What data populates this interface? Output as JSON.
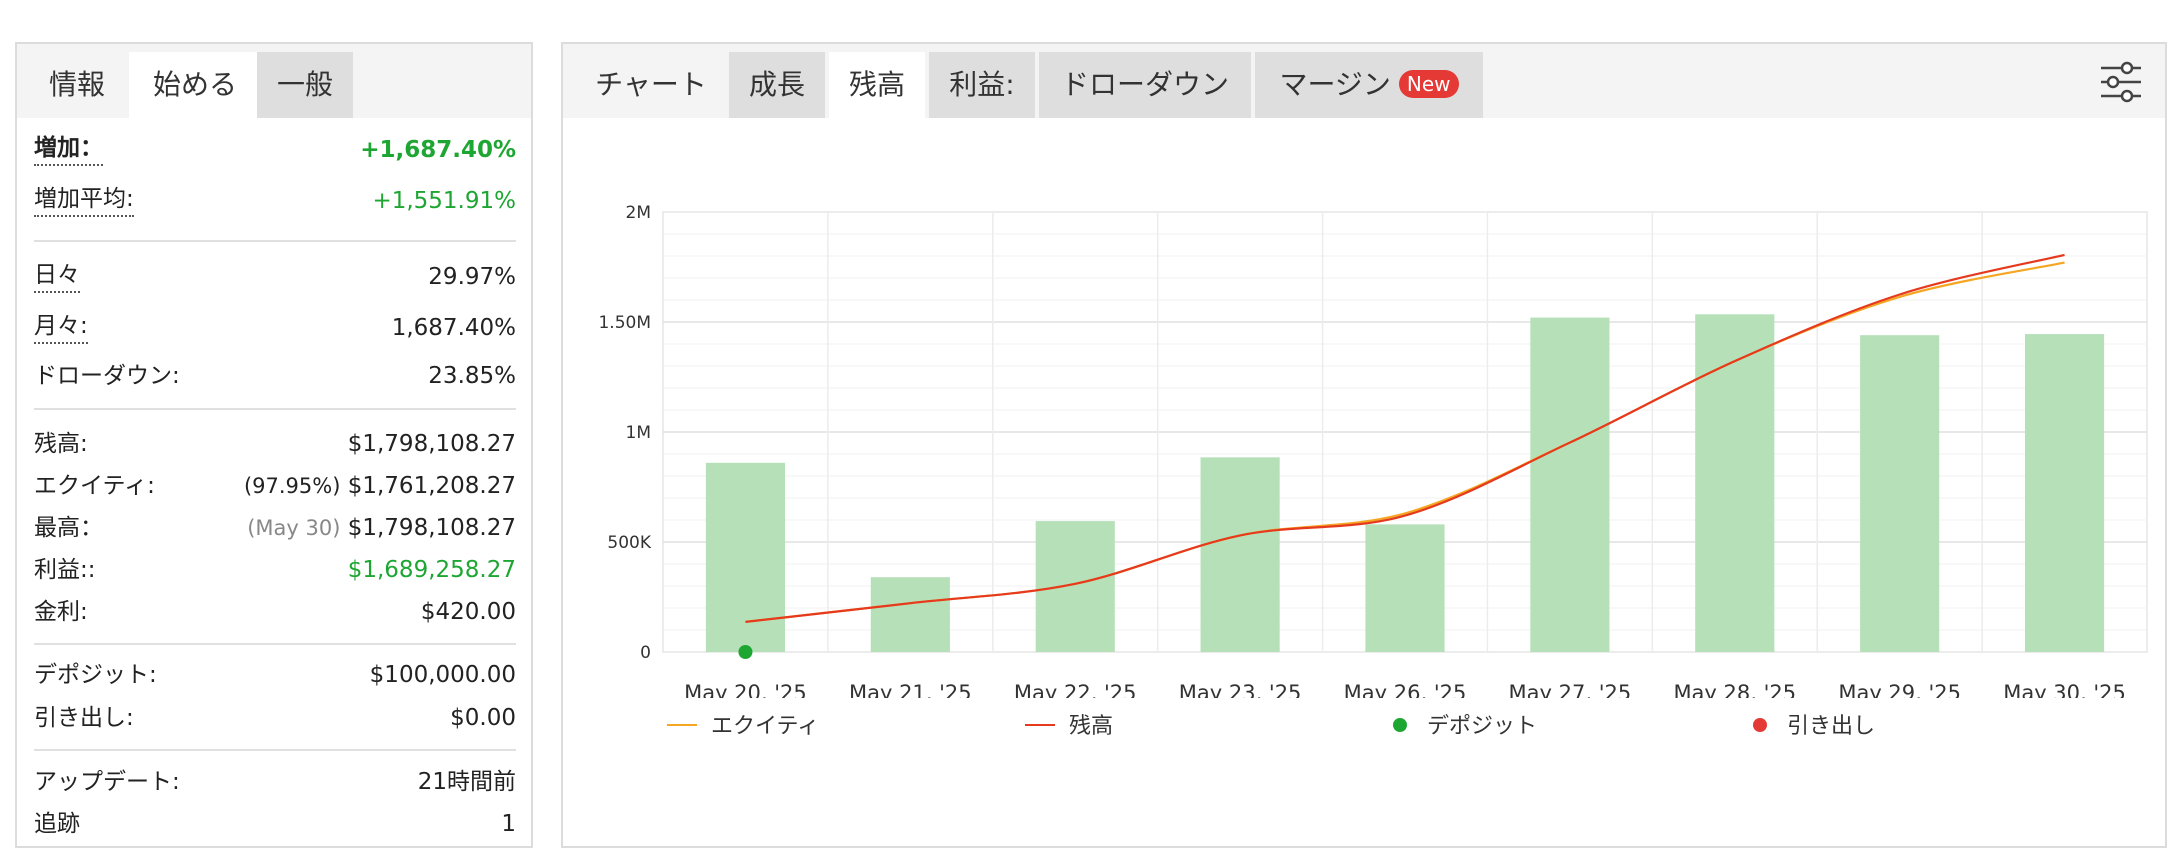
{
  "left_panel": {
    "tabs": [
      {
        "label": "情報"
      },
      {
        "label": "始める"
      },
      {
        "label": "一般"
      }
    ],
    "stats": {
      "gain": {
        "label": "増加：",
        "value": "+1,687.40%"
      },
      "abs_gain": {
        "label": "増加平均:",
        "value": "+1,551.91%"
      },
      "daily": {
        "label": "日々",
        "value": "29.97%"
      },
      "monthly": {
        "label": "月々:",
        "value": "1,687.40%"
      },
      "drawdown": {
        "label": "ドローダウン:",
        "value": "23.85%"
      },
      "balance": {
        "label": "残高:",
        "value": "$1,798,108.27"
      },
      "equity": {
        "label": "エクイティ:",
        "pct": "(97.95%)",
        "value": "$1,761,208.27"
      },
      "highest": {
        "label": "最高：",
        "date": "(May 30)",
        "value": "$1,798,108.27"
      },
      "profit": {
        "label": "利益::",
        "value": "$1,689,258.27"
      },
      "interest": {
        "label": "金利:",
        "value": "$420.00"
      },
      "deposits": {
        "label": "デポジット:",
        "value": "$100,000.00"
      },
      "withdrawals": {
        "label": "引き出し:",
        "value": "$0.00"
      },
      "updated": {
        "label": "アップデート:",
        "value": "21時間前"
      },
      "tracking": {
        "label": "追跡",
        "value": "1"
      }
    }
  },
  "right_panel": {
    "tabs": [
      {
        "label": "チャート"
      },
      {
        "label": "成長"
      },
      {
        "label": "残高"
      },
      {
        "label": "利益:"
      },
      {
        "label": "ドローダウン"
      },
      {
        "label": "マージン"
      }
    ],
    "new_badge": "New",
    "settings_icon": "sliders-icon"
  },
  "chart_data": {
    "type": "bar",
    "categories": [
      "May 20, '25",
      "May 21, '25",
      "May 22, '25",
      "May 23, '25",
      "May 26, '25",
      "May 27, '25",
      "May 28, '25",
      "May 29, '25",
      "May 30, '25"
    ],
    "y_tick_labels": [
      "0",
      "500K",
      "1M",
      "1.50M",
      "2M"
    ],
    "ylim": [
      0,
      2000000
    ],
    "bars": {
      "color": "#b5e0b8",
      "values": [
        860000,
        340000,
        595000,
        885000,
        580000,
        1520000,
        1535000,
        1440000,
        1445000
      ]
    },
    "lines": [
      {
        "name": "エクイティ",
        "color": "#f5a623",
        "values": [
          137000,
          222000,
          310000,
          530000,
          630000,
          952000,
          1322000,
          1614000,
          1770000
        ]
      },
      {
        "name": "残高",
        "color": "#e53a1e",
        "values": [
          137000,
          222000,
          310000,
          530000,
          620000,
          952000,
          1322000,
          1625000,
          1805000
        ]
      }
    ],
    "deposit_point": {
      "category_index": 0,
      "value": 0
    },
    "legend": [
      {
        "name": "エクイティ",
        "type": "line",
        "color": "#f5a623"
      },
      {
        "name": "残高",
        "type": "line",
        "color": "#e53a1e"
      },
      {
        "name": "デポジット",
        "type": "dot",
        "color": "#1ea633"
      },
      {
        "name": "引き出し",
        "type": "dot",
        "color": "#e53935"
      }
    ],
    "grid": true,
    "legend_placement": "bottom"
  }
}
